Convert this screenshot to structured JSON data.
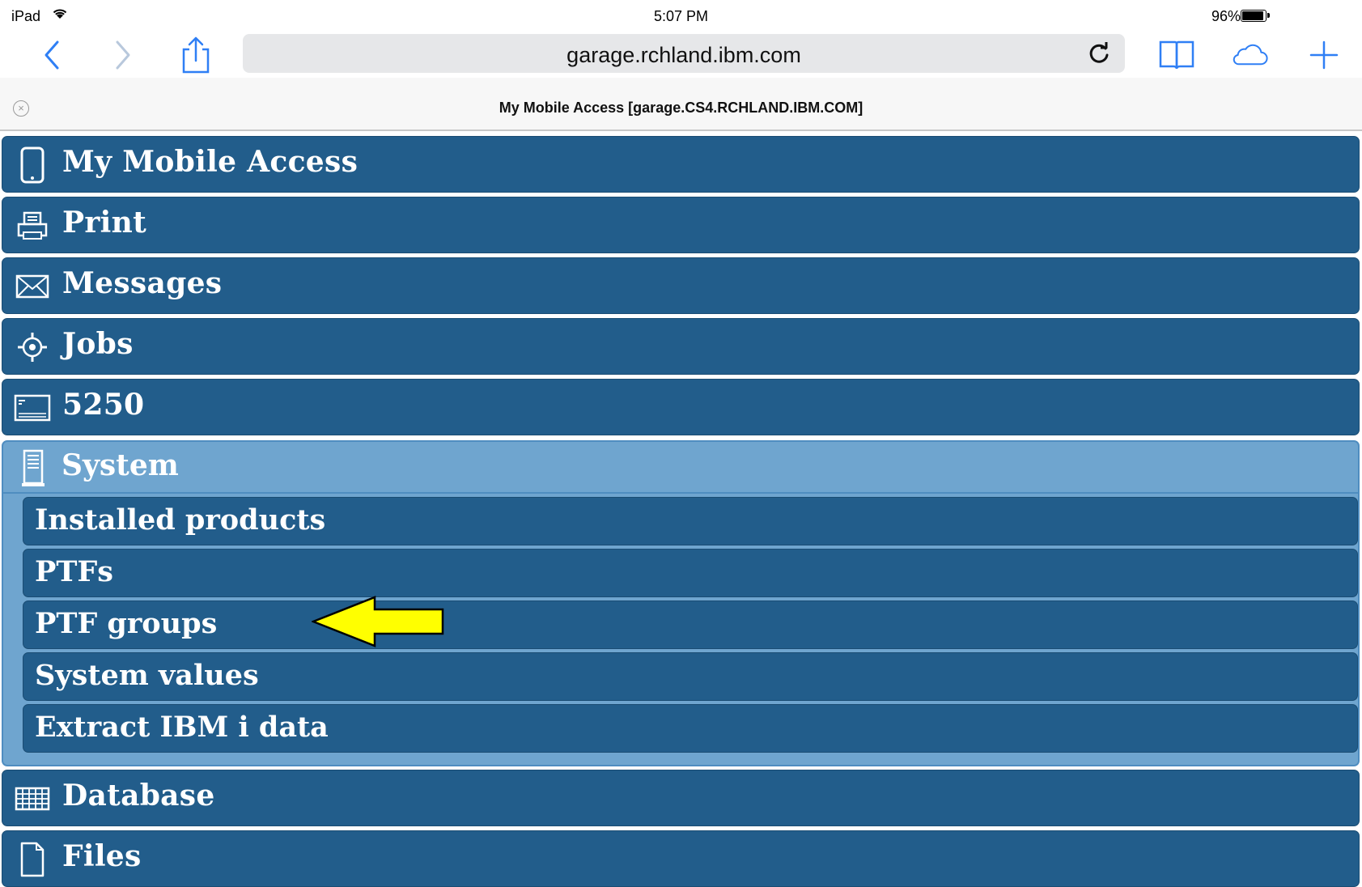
{
  "status_bar": {
    "device": "iPad",
    "time": "5:07 PM",
    "battery": "96%"
  },
  "browser": {
    "url": "garage.rchland.ibm.com",
    "tab_title": "My Mobile Access [garage.CS4.RCHLAND.IBM.COM]"
  },
  "menu": {
    "items": [
      {
        "label": "My Mobile Access",
        "icon": "mobile-phone-icon"
      },
      {
        "label": "Print",
        "icon": "printer-icon"
      },
      {
        "label": "Messages",
        "icon": "envelope-icon"
      },
      {
        "label": "Jobs",
        "icon": "gear-icon"
      },
      {
        "label": "5250",
        "icon": "terminal-icon"
      },
      {
        "label": "System",
        "icon": "server-icon",
        "expanded": true
      },
      {
        "label": "Database",
        "icon": "table-grid-icon"
      },
      {
        "label": "Files",
        "icon": "file-icon"
      }
    ],
    "system_subitems": [
      {
        "label": "Installed products"
      },
      {
        "label": "PTFs"
      },
      {
        "label": "PTF groups"
      },
      {
        "label": "System values"
      },
      {
        "label": "Extract IBM i data"
      }
    ]
  },
  "annotation": {
    "arrow_color": "#ffff00",
    "points_to": "PTF groups"
  },
  "colors": {
    "menu_row": "#225d8b",
    "expanded_group": "#6fa5cf",
    "ios_blue": "#2f7ff5"
  }
}
